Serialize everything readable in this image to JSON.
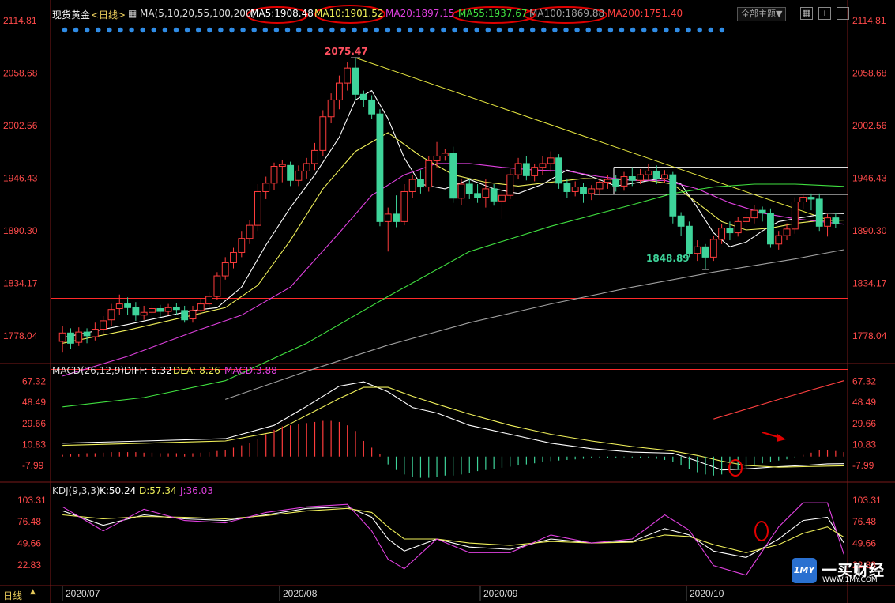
{
  "header": {
    "symbol": "现货黄金",
    "period": "<日线>",
    "ma_label": "MA(5,10,20,55,100,200)",
    "ma5": "MA5:1908.48",
    "ma10": "MA10:1901.52",
    "ma20": "MA20:1897.15",
    "ma55": "MA55:1937.67",
    "ma100": "MA100:1869.88",
    "ma200": "MA200:1751.40",
    "theme_button": "全部主题▼"
  },
  "colors": {
    "up": "#ff3c3c",
    "down": "#3ed49a",
    "ma5": "#ffffff",
    "ma10": "#f0f05a",
    "ma20": "#e040e0",
    "ma55": "#40e040",
    "ma100": "#a0a0a0",
    "ma200": "#ff4040"
  },
  "price_axis_ticks": [
    "2114.81",
    "2058.68",
    "2002.56",
    "1946.43",
    "1890.30",
    "1834.17",
    "1778.04"
  ],
  "annotations": {
    "high": "2075.47",
    "low": "1848.89"
  },
  "macd": {
    "label": "MACD(26,12,9)",
    "diff": "DIFF:-6.32",
    "dea": "DEA:-8.26",
    "macd": "MACD:3.88",
    "ticks": [
      "67.32",
      "48.49",
      "29.66",
      "10.83",
      "-7.99"
    ]
  },
  "kdj": {
    "label": "KDJ(9,3,3)",
    "k": "K:50.24",
    "d": "D:57.34",
    "j": "J:36.03",
    "ticks": [
      "103.31",
      "76.48",
      "49.66",
      "22.83"
    ]
  },
  "x_axis": {
    "period_tab": "日线",
    "labels": [
      "2020/07",
      "2020/08",
      "2020/09",
      "2020/10"
    ]
  },
  "logo": {
    "mark": "1MY",
    "name": "一买财经",
    "url": "WWW.1MY.COM"
  },
  "chart_data": {
    "type": "candlestick",
    "price_ylim": [
      1750,
      2130
    ],
    "candles": [
      [
        1772,
        1781,
        1760,
        1788
      ],
      [
        1781,
        1770,
        1764,
        1786
      ],
      [
        1771,
        1782,
        1767,
        1787
      ],
      [
        1782,
        1778,
        1770,
        1786
      ],
      [
        1777,
        1785,
        1773,
        1792
      ],
      [
        1785,
        1794,
        1780,
        1799
      ],
      [
        1795,
        1806,
        1788,
        1812
      ],
      [
        1807,
        1812,
        1800,
        1822
      ],
      [
        1812,
        1808,
        1800,
        1819
      ],
      [
        1808,
        1800,
        1794,
        1814
      ],
      [
        1800,
        1803,
        1795,
        1810
      ],
      [
        1803,
        1807,
        1798,
        1812
      ],
      [
        1807,
        1804,
        1798,
        1811
      ],
      [
        1804,
        1808,
        1800,
        1812
      ],
      [
        1808,
        1806,
        1800,
        1813
      ],
      [
        1805,
        1795,
        1792,
        1810
      ],
      [
        1796,
        1805,
        1792,
        1810
      ],
      [
        1805,
        1812,
        1800,
        1818
      ],
      [
        1812,
        1820,
        1808,
        1825
      ],
      [
        1820,
        1842,
        1816,
        1846
      ],
      [
        1842,
        1856,
        1838,
        1862
      ],
      [
        1856,
        1867,
        1850,
        1872
      ],
      [
        1867,
        1882,
        1862,
        1890
      ],
      [
        1882,
        1896,
        1876,
        1902
      ],
      [
        1896,
        1932,
        1890,
        1940
      ],
      [
        1932,
        1941,
        1924,
        1948
      ],
      [
        1941,
        1959,
        1934,
        1963
      ],
      [
        1959,
        1961,
        1942,
        1966
      ],
      [
        1960,
        1944,
        1938,
        1964
      ],
      [
        1944,
        1954,
        1938,
        1960
      ],
      [
        1954,
        1962,
        1946,
        1968
      ],
      [
        1962,
        1976,
        1955,
        1984
      ],
      [
        1976,
        2012,
        1970,
        2019
      ],
      [
        2012,
        2030,
        2005,
        2037
      ],
      [
        2030,
        2048,
        2020,
        2056
      ],
      [
        2048,
        2064,
        2040,
        2070
      ],
      [
        2064,
        2036,
        2030,
        2075.47
      ],
      [
        2036,
        2030,
        2022,
        2040
      ],
      [
        2030,
        2015,
        2010,
        2035
      ],
      [
        2015,
        1900,
        1895,
        2020
      ],
      [
        1900,
        1908,
        1868,
        1915
      ],
      [
        1908,
        1900,
        1894,
        1928
      ],
      [
        1900,
        1932,
        1896,
        1940
      ],
      [
        1932,
        1945,
        1925,
        1950
      ],
      [
        1945,
        1937,
        1930,
        1955
      ],
      [
        1937,
        1965,
        1932,
        1970
      ],
      [
        1965,
        1970,
        1958,
        1985
      ],
      [
        1970,
        1973,
        1965,
        1978
      ],
      [
        1973,
        1925,
        1920,
        1980
      ],
      [
        1925,
        1940,
        1918,
        1946
      ],
      [
        1940,
        1930,
        1924,
        1945
      ],
      [
        1930,
        1926,
        1920,
        1940
      ],
      [
        1926,
        1935,
        1915,
        1945
      ],
      [
        1935,
        1922,
        1917,
        1940
      ],
      [
        1922,
        1928,
        1903,
        1935
      ],
      [
        1928,
        1950,
        1924,
        1956
      ],
      [
        1950,
        1962,
        1945,
        1968
      ],
      [
        1962,
        1949,
        1944,
        1970
      ],
      [
        1949,
        1958,
        1943,
        1962
      ],
      [
        1958,
        1962,
        1950,
        1970
      ],
      [
        1962,
        1968,
        1953,
        1975
      ],
      [
        1968,
        1941,
        1935,
        1972
      ],
      [
        1941,
        1932,
        1925,
        1946
      ],
      [
        1932,
        1937,
        1927,
        1943
      ],
      [
        1937,
        1930,
        1920,
        1941
      ],
      [
        1930,
        1935,
        1923,
        1939
      ],
      [
        1935,
        1942,
        1928,
        1946
      ],
      [
        1942,
        1945,
        1935,
        1950
      ],
      [
        1945,
        1938,
        1932,
        1950
      ],
      [
        1938,
        1948,
        1933,
        1953
      ],
      [
        1948,
        1944,
        1938,
        1958
      ],
      [
        1944,
        1950,
        1940,
        1956
      ],
      [
        1950,
        1954,
        1944,
        1962
      ],
      [
        1954,
        1946,
        1940,
        1960
      ],
      [
        1946,
        1950,
        1941,
        1955
      ],
      [
        1950,
        1906,
        1898,
        1953
      ],
      [
        1906,
        1895,
        1885,
        1910
      ],
      [
        1895,
        1866,
        1862,
        1900
      ],
      [
        1866,
        1873,
        1858,
        1880
      ],
      [
        1873,
        1862,
        1848.89,
        1876
      ],
      [
        1862,
        1881,
        1858,
        1885
      ],
      [
        1881,
        1893,
        1876,
        1897
      ],
      [
        1893,
        1888,
        1880,
        1900
      ],
      [
        1888,
        1900,
        1884,
        1905
      ],
      [
        1900,
        1904,
        1893,
        1910
      ],
      [
        1904,
        1912,
        1898,
        1918
      ],
      [
        1912,
        1909,
        1900,
        1916
      ],
      [
        1909,
        1876,
        1872,
        1914
      ],
      [
        1876,
        1885,
        1870,
        1890
      ],
      [
        1885,
        1892,
        1880,
        1898
      ],
      [
        1892,
        1921,
        1887,
        1926
      ],
      [
        1921,
        1926,
        1913,
        1930
      ],
      [
        1926,
        1924,
        1912,
        1930
      ],
      [
        1924,
        1895,
        1890,
        1930
      ],
      [
        1895,
        1904,
        1884,
        1908
      ],
      [
        1904,
        1898,
        1893,
        1909
      ]
    ],
    "macd_ylim": [
      -20,
      72
    ],
    "macd_hist": [
      1.5,
      2,
      2.5,
      3,
      3,
      3.5,
      4,
      4,
      4,
      4,
      3.5,
      3.5,
      3,
      3,
      3,
      2.5,
      3,
      3.5,
      4,
      5,
      6,
      8,
      10,
      12,
      16,
      20,
      24,
      27,
      28,
      29,
      30,
      31,
      32,
      32,
      31,
      28,
      23,
      14,
      8,
      2,
      -7,
      -12,
      -16,
      -18,
      -19,
      -19,
      -18,
      -17,
      -17,
      -16,
      -15,
      -13,
      -12,
      -11,
      -10,
      -9,
      -8,
      -7,
      -6,
      -5,
      -4,
      -3.5,
      -3,
      -2.5,
      -2,
      -1.5,
      -1.2,
      -1,
      -0.8,
      -0.6,
      -0.8,
      -1,
      -1.5,
      -2,
      -3,
      -5,
      -8,
      -11,
      -14,
      -16,
      -17,
      -16,
      -14,
      -12,
      -10,
      -8,
      -6,
      -5,
      -3.5,
      -2.5,
      -1.5,
      1.5,
      3.5,
      5.5,
      6,
      5,
      4
    ],
    "kdj_ylim": [
      0,
      110
    ],
    "series": [
      {
        "name": "MA5",
        "x": [
          0,
          8,
          16,
          19,
          22,
          25,
          28,
          31,
          34,
          36,
          38,
          40,
          42,
          44,
          47,
          50,
          53,
          56,
          59,
          62,
          65,
          68,
          71,
          74,
          76,
          78,
          80,
          82,
          84,
          86,
          88,
          90,
          92,
          94,
          96
        ],
        "values": [
          1776,
          1790,
          1805,
          1808,
          1830,
          1875,
          1915,
          1950,
          1990,
          2030,
          2040,
          2010,
          1968,
          1940,
          1935,
          1945,
          1935,
          1930,
          1940,
          1955,
          1948,
          1938,
          1942,
          1947,
          1940,
          1915,
          1888,
          1873,
          1878,
          1890,
          1900,
          1903,
          1906,
          1909,
          1908.48
        ]
      },
      {
        "name": "MA10",
        "x": [
          0,
          8,
          16,
          20,
          24,
          28,
          32,
          36,
          40,
          44,
          48,
          52,
          56,
          60,
          64,
          68,
          72,
          75,
          78,
          81,
          84,
          87,
          90,
          93,
          96
        ],
        "values": [
          1770,
          1784,
          1800,
          1808,
          1832,
          1880,
          1935,
          1975,
          1995,
          1970,
          1950,
          1942,
          1938,
          1942,
          1946,
          1945,
          1944,
          1940,
          1920,
          1900,
          1891,
          1893,
          1898,
          1901,
          1901.52
        ]
      },
      {
        "name": "MA20",
        "x": [
          0,
          8,
          16,
          22,
          28,
          34,
          38,
          42,
          46,
          50,
          54,
          58,
          62,
          66,
          70,
          74,
          78,
          82,
          86,
          90,
          96
        ],
        "values": [
          1735,
          1756,
          1782,
          1800,
          1830,
          1888,
          1928,
          1950,
          1962,
          1962,
          1958,
          1955,
          1954,
          1948,
          1944,
          1944,
          1935,
          1920,
          1909,
          1903,
          1897.15
        ]
      },
      {
        "name": "MA55",
        "x": [
          0,
          10,
          20,
          30,
          40,
          50,
          60,
          70,
          75,
          80,
          85,
          90,
          96
        ],
        "values": [
          1702,
          1712,
          1730,
          1770,
          1820,
          1868,
          1895,
          1918,
          1930,
          1937,
          1940,
          1940,
          1937.67
        ]
      },
      {
        "name": "MA100",
        "x": [
          20,
          30,
          40,
          50,
          60,
          70,
          80,
          90,
          96
        ],
        "values": [
          1710,
          1740,
          1768,
          1792,
          1812,
          1830,
          1846,
          1860,
          1869.88
        ]
      },
      {
        "name": "MA200",
        "x": [
          80,
          88,
          96
        ],
        "values": [
          1689,
          1710,
          1730
        ]
      },
      {
        "name": "DIFF",
        "x": [
          0,
          10,
          20,
          26,
          30,
          34,
          37,
          40,
          43,
          46,
          50,
          55,
          60,
          65,
          70,
          75,
          78,
          81,
          84,
          88,
          91,
          94,
          96
        ],
        "values": [
          12,
          14,
          16,
          28,
          45,
          63,
          67,
          58,
          44,
          39,
          28,
          20,
          12,
          7,
          4,
          3,
          -4,
          -12,
          -11,
          -9,
          -8,
          -6.5,
          -6.32
        ]
      },
      {
        "name": "DEA",
        "x": [
          0,
          10,
          20,
          26,
          30,
          34,
          37,
          40,
          43,
          46,
          50,
          55,
          60,
          65,
          70,
          75,
          78,
          81,
          84,
          88,
          91,
          94,
          96
        ],
        "values": [
          10,
          12,
          14,
          22,
          37,
          52,
          62,
          62,
          54,
          47,
          38,
          28,
          20,
          14,
          9,
          5,
          1,
          -4,
          -8,
          -9.5,
          -9,
          -8.5,
          -8.26
        ]
      },
      {
        "name": "K",
        "x": [
          0,
          5,
          10,
          15,
          20,
          25,
          30,
          35,
          38,
          40,
          42,
          46,
          50,
          55,
          60,
          65,
          70,
          74,
          77,
          80,
          84,
          88,
          91,
          94,
          96
        ],
        "values": [
          90,
          72,
          85,
          80,
          78,
          85,
          93,
          95,
          82,
          55,
          40,
          55,
          45,
          42,
          55,
          50,
          52,
          68,
          60,
          40,
          32,
          55,
          78,
          82,
          50.24
        ]
      },
      {
        "name": "D",
        "x": [
          0,
          5,
          10,
          15,
          20,
          25,
          30,
          35,
          38,
          40,
          42,
          46,
          50,
          55,
          60,
          65,
          70,
          74,
          77,
          80,
          84,
          88,
          91,
          94,
          96
        ],
        "values": [
          85,
          80,
          83,
          82,
          80,
          84,
          90,
          93,
          88,
          70,
          55,
          55,
          50,
          47,
          52,
          50,
          51,
          60,
          58,
          48,
          38,
          48,
          62,
          70,
          57.34
        ]
      },
      {
        "name": "J",
        "x": [
          0,
          5,
          10,
          15,
          20,
          25,
          30,
          35,
          38,
          40,
          42,
          46,
          50,
          55,
          60,
          65,
          70,
          74,
          77,
          80,
          84,
          88,
          91,
          94,
          96
        ],
        "values": [
          95,
          65,
          92,
          78,
          75,
          88,
          95,
          98,
          65,
          30,
          18,
          55,
          38,
          38,
          60,
          50,
          55,
          85,
          66,
          22,
          10,
          70,
          100,
          100,
          36.03
        ]
      }
    ]
  }
}
